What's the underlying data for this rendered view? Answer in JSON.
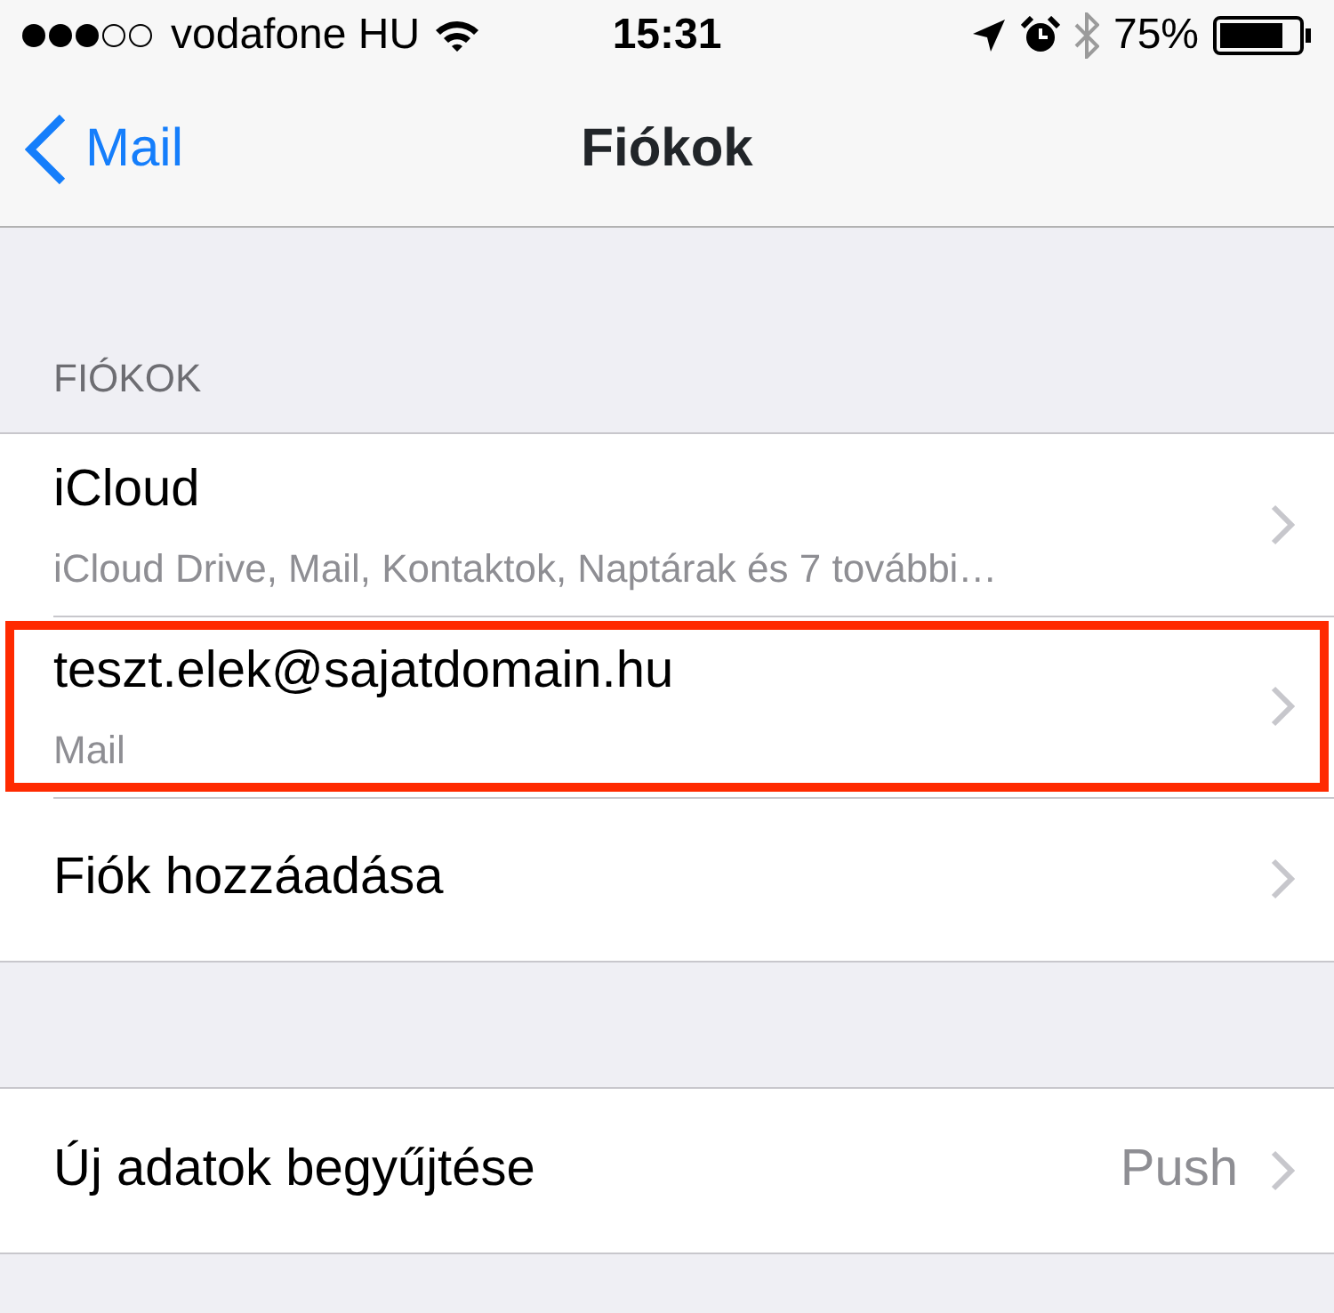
{
  "status_bar": {
    "carrier": "vodafone HU",
    "time": "15:31",
    "battery": "75%"
  },
  "nav": {
    "back": "Mail",
    "title": "Fiókok"
  },
  "sections": [
    {
      "header": "FIÓKOK",
      "rows": [
        {
          "title": "iCloud",
          "subtitle": "iCloud Drive, Mail, Kontaktok, Naptárak és 7 további…",
          "highlighted": false
        },
        {
          "title": "teszt.elek@sajatdomain.hu",
          "subtitle": "Mail",
          "highlighted": true
        },
        {
          "title": "Fiók hozzáadása",
          "highlighted": false
        }
      ]
    },
    {
      "rows": [
        {
          "title": "Új adatok begyűjtése",
          "value": "Push",
          "highlighted": false
        }
      ]
    }
  ]
}
